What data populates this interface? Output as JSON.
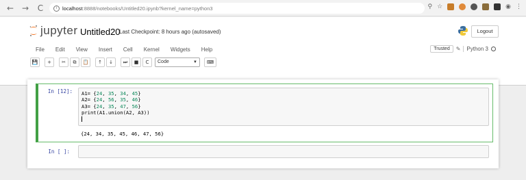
{
  "browser": {
    "back_icon": "←",
    "forward_icon": "→",
    "reload_icon": "C",
    "home_icon": "⌂",
    "url_host": "localhost",
    "url_rest": ":8888/notebooks/Untitled20.ipynb?kernel_name=python3",
    "right_icons": [
      "zoom-icon",
      "star-icon",
      "extension-icon",
      "extension-icon",
      "extension-icon",
      "extension-icon",
      "extension-icon",
      "account-icon",
      "menu-icon"
    ],
    "menu_glyph": "⋮"
  },
  "header": {
    "logo_text": "jupyter",
    "notebook_name": "Untitled20",
    "checkpoint": "Last Checkpoint: 8 hours ago (autosaved)",
    "logout_label": "Logout"
  },
  "menu": {
    "items": [
      "File",
      "Edit",
      "View",
      "Insert",
      "Cell",
      "Kernel",
      "Widgets",
      "Help"
    ],
    "trusted_label": "Trusted",
    "kernel_name": "Python 3"
  },
  "toolbar": {
    "buttons": [
      "💾",
      "+",
      "✂",
      "⧉",
      "📋",
      "↑",
      "↓",
      "⏭",
      "■",
      "C"
    ],
    "cell_type": "Code",
    "keyboard_icon": "⌨"
  },
  "cells": [
    {
      "prompt": "In [12]:",
      "code": [
        {
          "pre": "A1= {",
          "nums": [
            "24",
            "35",
            "34",
            "45"
          ],
          "post": "}"
        },
        {
          "pre": "A2= {",
          "nums": [
            "24",
            "56",
            "35",
            "46"
          ],
          "post": "}"
        },
        {
          "pre": "A3= {",
          "nums": [
            "24",
            "35",
            "47",
            "56"
          ],
          "post": "}"
        }
      ],
      "print_line": "print(A1.union(A2, A3))",
      "output": "{24, 34, 35, 45, 46, 47, 56}"
    },
    {
      "prompt": "In [ ]:"
    }
  ],
  "colors": {
    "accent_green": "#42a045",
    "prompt_blue": "#303f9f",
    "number_green": "#098658"
  }
}
